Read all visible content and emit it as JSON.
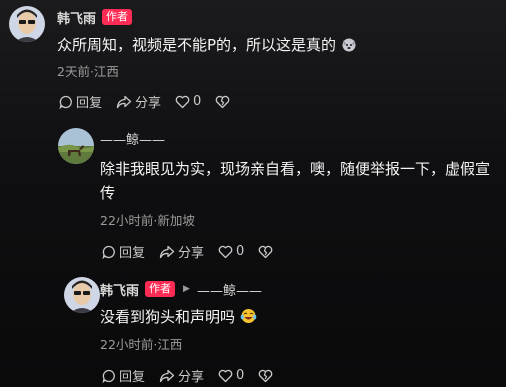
{
  "comments": [
    {
      "username": "韩飞雨",
      "badge": "作者",
      "text": "众所周知，视频是不能P的，所以这是真的",
      "meta": "2天前·江西",
      "actions": {
        "reply": "回复",
        "share": "分享",
        "likes": "0"
      }
    },
    {
      "username": "——鲸——",
      "text": "除非我眼见为实，现场亲自看，噢，随便举报一下，虚假宣传",
      "meta": "22小时前·新加坡",
      "actions": {
        "reply": "回复",
        "share": "分享",
        "likes": "0"
      }
    },
    {
      "username": "韩飞雨",
      "badge": "作者",
      "reply_to": "——鲸——",
      "text": "没看到狗头和声明吗",
      "meta": "22小时前·江西",
      "actions": {
        "reply": "回复",
        "share": "分享",
        "likes": "0"
      }
    }
  ],
  "icons": {
    "reply": "reply-bubble-icon",
    "share": "share-arrow-icon",
    "like": "heart-icon",
    "dislike": "broken-heart-icon",
    "emoji1": "doge-emoji",
    "emoji2": "laughing-tears-emoji"
  },
  "colors": {
    "badge": "#fe2c55",
    "meta": "#9b9b9b"
  }
}
